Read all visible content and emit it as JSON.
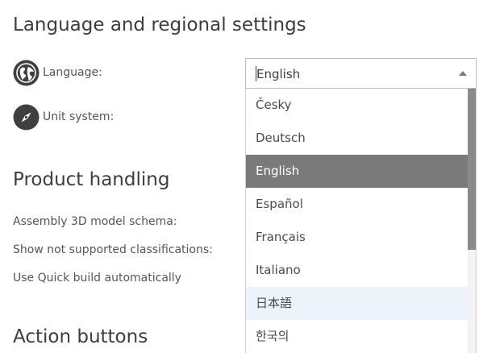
{
  "sections": {
    "language_regional": {
      "title": "Language and regional settings",
      "language_label": "Language:",
      "language_icon": "globe-icon",
      "unit_label": "Unit system:",
      "unit_icon": "compass-icon"
    },
    "product_handling": {
      "title": "Product handling",
      "assembly_label": "Assembly 3D model schema:",
      "classifications_label": "Show not supported classifications:",
      "quick_build_label": "Use Quick build automatically"
    },
    "action_buttons": {
      "title": "Action buttons"
    }
  },
  "language_dropdown": {
    "selected_value": "English",
    "options": [
      {
        "label": "Česky"
      },
      {
        "label": "Deutsch"
      },
      {
        "label": "English",
        "state": "selected"
      },
      {
        "label": "Español"
      },
      {
        "label": "Français"
      },
      {
        "label": "Italiano"
      },
      {
        "label": "日本語",
        "state": "hovered"
      },
      {
        "label": "한국의"
      }
    ],
    "scroll_position": 0,
    "visible_fraction": 0.61
  },
  "colors": {
    "icon_dark": "#3f3f3f",
    "selected_bg": "#7a7a7a",
    "hover_bg": "#ecf3fb",
    "scroll_thumb": "#8a8a8a"
  }
}
